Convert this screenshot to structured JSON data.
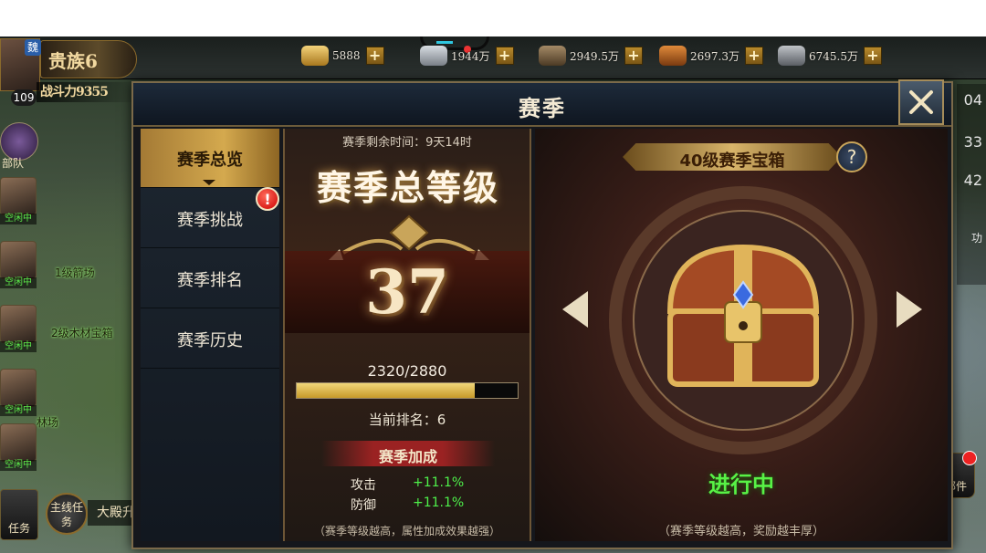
{
  "resources": [
    {
      "icon": "gold-ingot-icon",
      "value": "5888"
    },
    {
      "icon": "silver-icon",
      "value": "1944万"
    },
    {
      "icon": "wood-icon",
      "value": "2949.5万"
    },
    {
      "icon": "food-icon",
      "value": "2697.3万"
    },
    {
      "icon": "iron-icon",
      "value": "6745.5万"
    }
  ],
  "player": {
    "noble": "贵族6",
    "power": "战斗力9355",
    "level": "109",
    "faction": "魏",
    "troop_label": "部队"
  },
  "map": {
    "heroes": [
      {
        "status": "空闲中"
      },
      {
        "status": "空闲中"
      },
      {
        "status": "空闲中"
      },
      {
        "status": "空闲中"
      },
      {
        "status": "空闲中"
      }
    ],
    "items": [
      "1级箭场",
      "2级木材宝箱",
      "林场"
    ],
    "quest_main": "主线任务",
    "quest_text": "大殿升",
    "task_label": "任务",
    "mail_label": "邮件",
    "right_nums": [
      "04",
      "33",
      "42"
    ],
    "right_side_label": "功"
  },
  "dialog": {
    "title": "赛季",
    "tabs": [
      "赛季总览",
      "赛季挑战",
      "赛季排名",
      "赛季历史"
    ],
    "active_tab": 0,
    "challenge_badge": "!",
    "remain_time": "赛季剩余时间：9天14时",
    "calligraphy": "赛季总等级",
    "level": "37",
    "progress_text": "2320/2880",
    "progress": 0.806,
    "rank": "当前排名：6",
    "bonus_header": "赛季加成",
    "stats": [
      {
        "label": "攻击",
        "value": "+11.1%"
      },
      {
        "label": "防御",
        "value": "+11.1%"
      }
    ],
    "mid_footer": "（赛季等级越高，属性加成效果越强）",
    "chest_title": "40级赛季宝箱",
    "help": "?",
    "status": "进行中",
    "right_footer": "（赛季等级越高，奖励越丰厚）"
  }
}
